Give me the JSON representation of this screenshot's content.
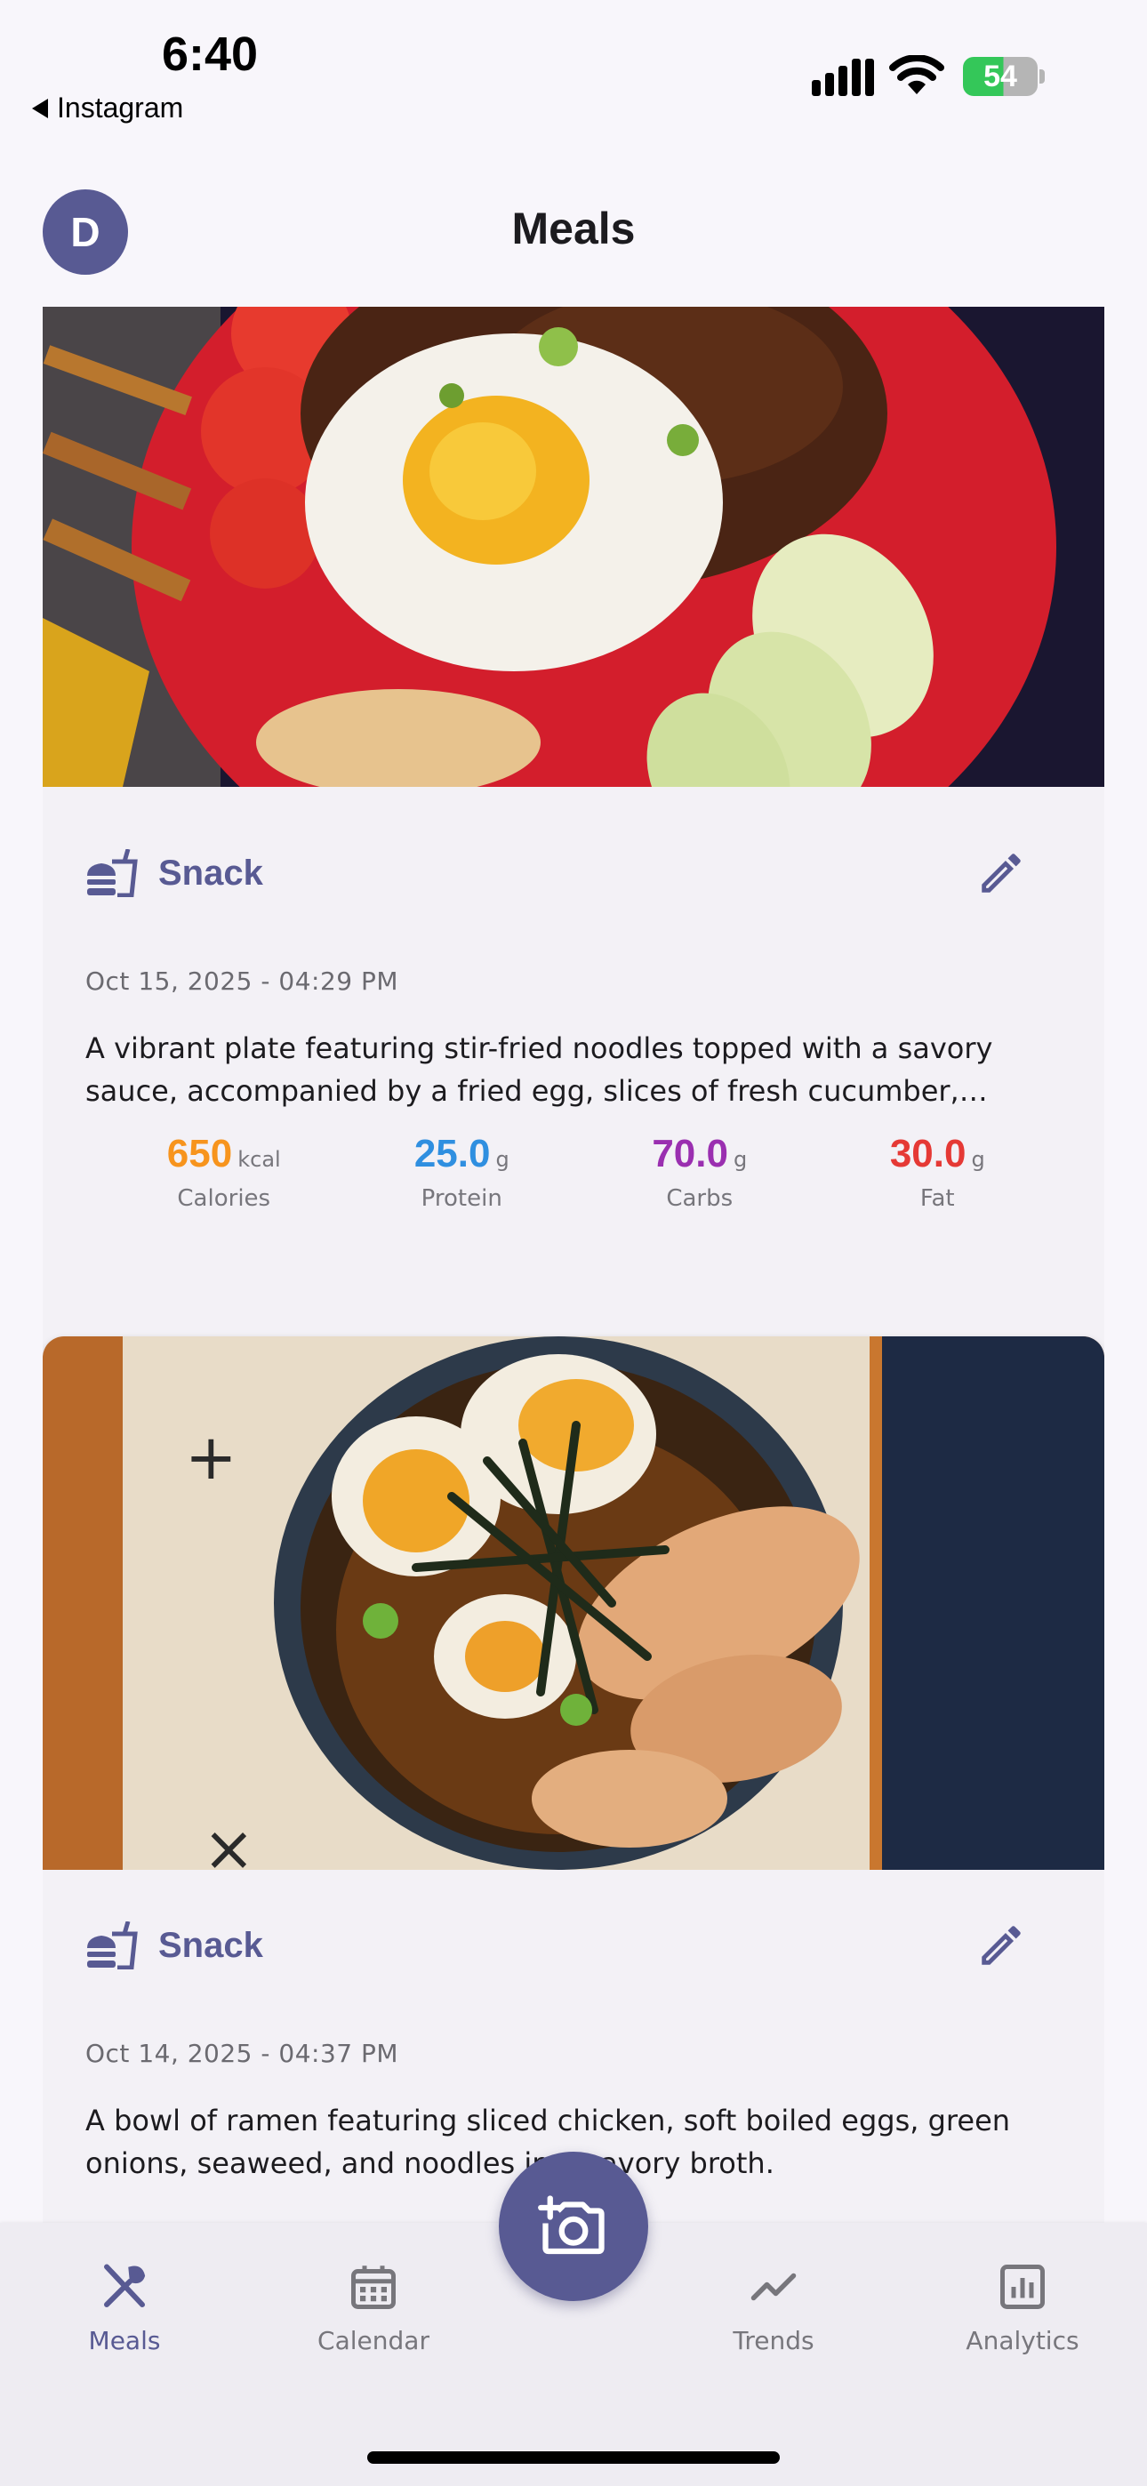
{
  "status_bar": {
    "time": "6:40",
    "back_app": "Instagram",
    "battery": "54"
  },
  "header": {
    "avatar_initial": "D",
    "title": "Meals"
  },
  "meals": [
    {
      "type": "Snack",
      "date": "Oct 15, 2025 - 04:29 PM",
      "description": "A vibrant plate featuring stir-fried noodles topped with a savory sauce, accompanied by a fried egg, slices of fresh cucumber, tomatoes and crackers.",
      "calories": {
        "value": "650",
        "unit": "kcal",
        "label": "Calories",
        "color": "#f7941d"
      },
      "protein": {
        "value": "25.0",
        "unit": "g",
        "label": "Protein",
        "color": "#2f8fe0"
      },
      "carbs": {
        "value": "70.0",
        "unit": "g",
        "label": "Carbs",
        "color": "#9a2fb0"
      },
      "fat": {
        "value": "30.0",
        "unit": "g",
        "label": "Fat",
        "color": "#e53935"
      }
    },
    {
      "type": "Snack",
      "date": "Oct 14, 2025 - 04:37 PM",
      "description": "A bowl of ramen featuring sliced chicken, soft boiled eggs, green onions, seaweed, and noodles in a savory broth."
    }
  ],
  "bottom_nav": {
    "items": [
      {
        "label": "Meals",
        "icon": "fork-knife-icon",
        "active": true
      },
      {
        "label": "Calendar",
        "icon": "calendar-icon",
        "active": false
      },
      {
        "label": "Trends",
        "icon": "trend-line-icon",
        "active": false
      },
      {
        "label": "Analytics",
        "icon": "bar-chart-icon",
        "active": false
      }
    ],
    "fab_icon": "add-photo-camera-icon"
  },
  "colors": {
    "accent": "#585a93",
    "background": "#f8f6fb",
    "card": "#f3f1f6"
  }
}
